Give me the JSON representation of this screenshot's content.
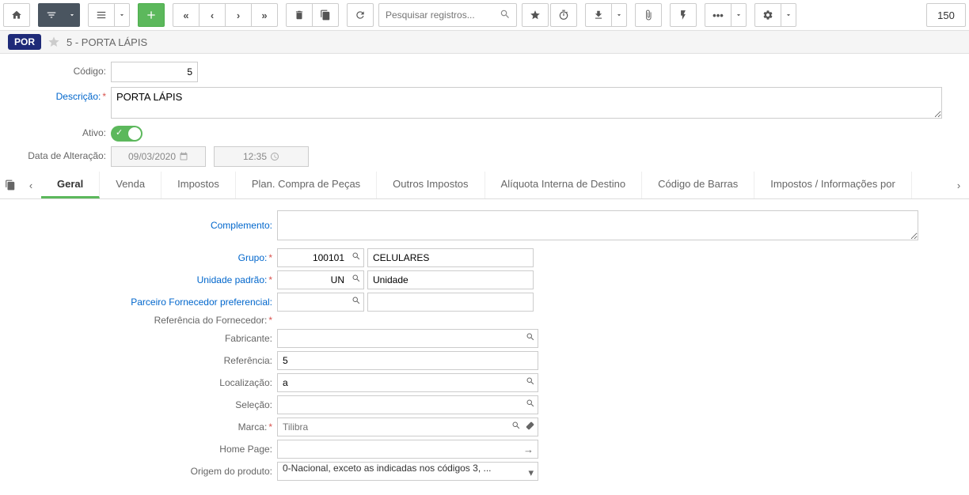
{
  "toolbar": {
    "search_placeholder": "Pesquisar registros...",
    "record_count": "150"
  },
  "header": {
    "badge": "POR",
    "title": "5 - PORTA LÁPIS"
  },
  "form": {
    "codigo_label": "Código:",
    "codigo_value": "5",
    "descricao_label": "Descrição:",
    "descricao_value": "PORTA LÁPIS",
    "ativo_label": "Ativo:",
    "data_alteracao_label": "Data de Alteração:",
    "data_value": "09/03/2020",
    "time_value": "12:35"
  },
  "tabs": [
    {
      "label": "Geral",
      "active": true
    },
    {
      "label": "Venda",
      "active": false
    },
    {
      "label": "Impostos",
      "active": false
    },
    {
      "label": "Plan. Compra de Peças",
      "active": false
    },
    {
      "label": "Outros Impostos",
      "active": false
    },
    {
      "label": "Alíquota Interna de Destino",
      "active": false
    },
    {
      "label": "Código de Barras",
      "active": false
    },
    {
      "label": "Impostos / Informações por",
      "active": false
    }
  ],
  "content": {
    "complemento_label": "Complemento:",
    "complemento_value": "",
    "grupo_label": "Grupo:",
    "grupo_code": "100101",
    "grupo_desc": "CELULARES",
    "unidade_label": "Unidade padrão:",
    "unidade_code": "UN",
    "unidade_desc": "Unidade",
    "parceiro_label": "Parceiro Fornecedor preferencial:",
    "parceiro_code": "",
    "parceiro_desc": "",
    "ref_forn_label": "Referência do Fornecedor:",
    "fabricante_label": "Fabricante:",
    "fabricante_value": "",
    "referencia_label": "Referência:",
    "referencia_value": "5",
    "localizacao_label": "Localização:",
    "localizacao_value": "a",
    "selecao_label": "Seleção:",
    "selecao_value": "",
    "marca_label": "Marca:",
    "marca_placeholder": "Tilibra",
    "homepage_label": "Home Page:",
    "homepage_value": "",
    "origem_label": "Origem do produto:",
    "origem_value": "0-Nacional, exceto as indicadas nos códigos 3, ..."
  }
}
